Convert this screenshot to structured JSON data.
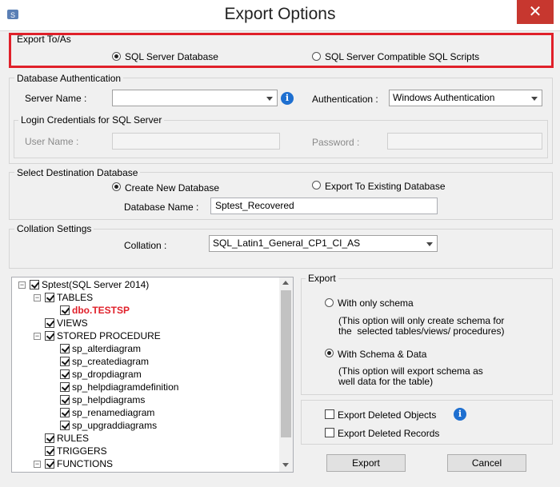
{
  "window": {
    "title": "Export Options",
    "close_glyph": "✕"
  },
  "export_to": {
    "legend": "Export To/As",
    "options": [
      "SQL Server Database",
      "SQL Server Compatible SQL Scripts"
    ],
    "selected": 0
  },
  "db_auth": {
    "legend": "Database Authentication",
    "server_label": "Server Name :",
    "server_value": "",
    "auth_label": "Authentication :",
    "auth_value": "Windows Authentication"
  },
  "login": {
    "legend": "Login Credentials for SQL Server",
    "user_label": "User Name :",
    "password_label": "Password :"
  },
  "destination": {
    "legend": "Select Destination Database",
    "create_label": "Create New Database",
    "existing_label": "Export To Existing Database",
    "dbname_label": "Database Name :",
    "dbname_value": "Sptest_Recovered"
  },
  "collation": {
    "legend": "Collation Settings",
    "label": "Collation :",
    "value": "SQL_Latin1_General_CP1_CI_AS"
  },
  "tree": {
    "root": "Sptest(SQL Server 2014)",
    "tables": "TABLES",
    "table_item": "dbo.TESTSP",
    "views": "VIEWS",
    "stored_procedure": "STORED PROCEDURE",
    "procedures": [
      "sp_alterdiagram",
      "sp_creatediagram",
      "sp_dropdiagram",
      "sp_helpdiagramdefinition",
      "sp_helpdiagrams",
      "sp_renamediagram",
      "sp_upgraddiagrams"
    ],
    "rules": "RULES",
    "triggers": "TRIGGERS",
    "functions": "FUNCTIONS"
  },
  "export": {
    "legend": "Export",
    "schema_only_label": "With only schema",
    "schema_only_desc1": "(This option will only create schema for",
    "schema_only_desc2": "the  selected tables/views/ procedures)",
    "schema_data_label": "With Schema & Data",
    "schema_data_desc1": "(This option will export schema as",
    "schema_data_desc2": "well data for the table)",
    "selected": "schema_data"
  },
  "deleted": {
    "objects_label": "Export Deleted Objects",
    "records_label": "Export Deleted Records"
  },
  "buttons": {
    "export": "Export",
    "cancel": "Cancel"
  },
  "colors": {
    "highlight": "#e0202a",
    "close": "#c7372f",
    "info": "#1e6fd0"
  }
}
